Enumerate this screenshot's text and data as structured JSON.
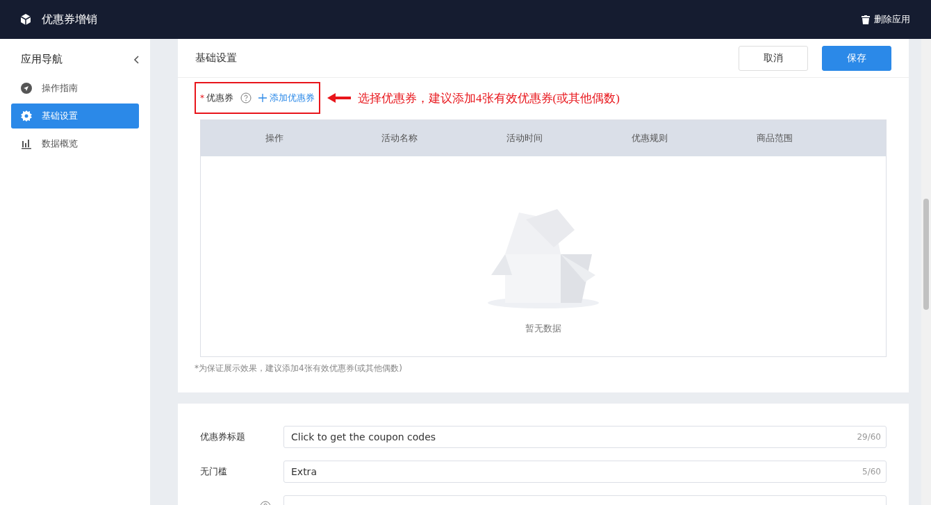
{
  "header": {
    "title": "优惠券增销",
    "delete_label": "删除应用"
  },
  "sidebar": {
    "title": "应用导航",
    "items": [
      {
        "label": "操作指南",
        "kind": "guide",
        "selected": false
      },
      {
        "label": "基础设置",
        "kind": "settings",
        "selected": true
      },
      {
        "label": "数据概览",
        "kind": "chart",
        "selected": false
      }
    ]
  },
  "settings_card": {
    "title": "基础设置",
    "buttons": [
      {
        "label": "取消",
        "kind": "default"
      },
      {
        "label": "保存",
        "kind": "primary"
      }
    ],
    "coupon_field": {
      "required_mark": "*",
      "label": "优惠券",
      "add_link": "添加优惠券"
    },
    "annotation": "选择优惠券，建议添加4张有效优惠券(或其他偶数)",
    "table": {
      "columns": [
        "操作",
        "活动名称",
        "活动时间",
        "优惠规则",
        "商品范围"
      ],
      "empty_text": "暂无数据"
    },
    "hint": "*为保证展示效果，建议添加4张有效优惠券(或其他偶数)"
  },
  "form_card": {
    "fields": [
      {
        "label": "优惠券标题",
        "value": "Click to get the coupon codes",
        "count": "29/60",
        "help": false
      },
      {
        "label": "无门槛",
        "value": "Extra",
        "count": "5/60",
        "help": false
      },
      {
        "help": true
      }
    ]
  }
}
